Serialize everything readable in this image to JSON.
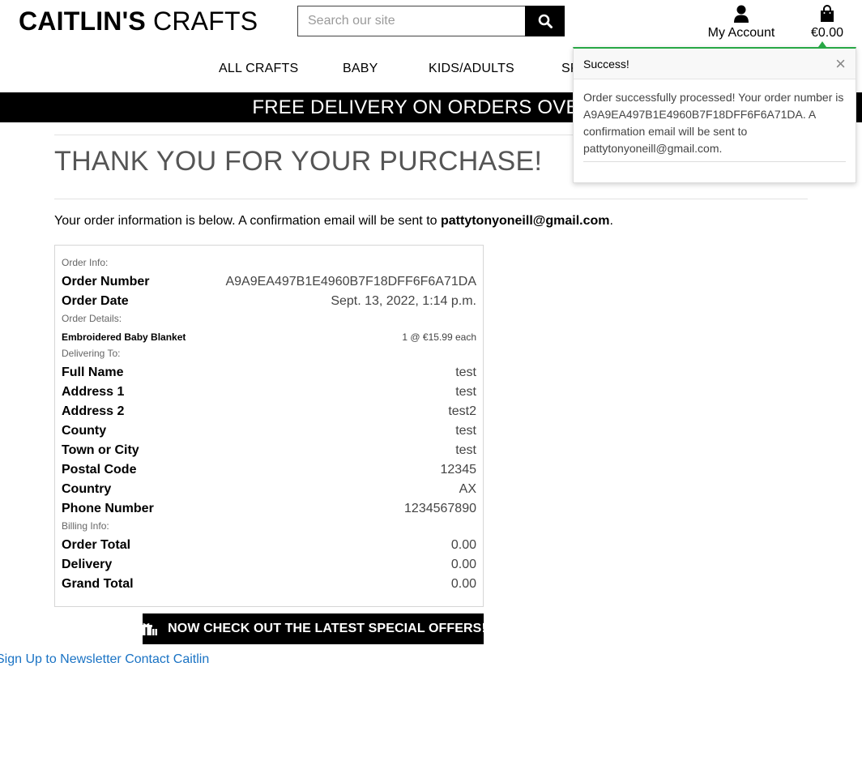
{
  "header": {
    "logo_bold": "CAITLIN'S",
    "logo_light": " CRAFTS",
    "search_placeholder": "Search our site",
    "account_label": "My Account",
    "cart_total": "€0.00"
  },
  "nav": {
    "items": [
      "ALL CRAFTS",
      "BABY",
      "KIDS/ADULTS",
      "SP"
    ]
  },
  "banner": "FREE DELIVERY ON ORDERS OVER €",
  "page": {
    "title": "THANK YOU FOR YOUR PURCHASE!",
    "intro_text": "Your order information is below. A confirmation email will be sent to ",
    "intro_email": "pattytonyoneill@gmail.com",
    "intro_end": "."
  },
  "order": {
    "order_info_heading": "Order Info:",
    "order_number_label": "Order Number",
    "order_number": "A9A9EA497B1E4960B7F18DFF6F6A71DA",
    "order_date_label": "Order Date",
    "order_date": "Sept. 13, 2022, 1:14 p.m.",
    "order_details_heading": "Order Details:",
    "item_name": "Embroidered Baby Blanket",
    "item_qty": "1 @ €15.99 each",
    "delivering_heading": "Delivering To:",
    "delivery": [
      {
        "label": "Full Name",
        "value": "test"
      },
      {
        "label": "Address 1",
        "value": "test"
      },
      {
        "label": "Address 2",
        "value": "test2"
      },
      {
        "label": "County",
        "value": "test"
      },
      {
        "label": "Town or City",
        "value": "test"
      },
      {
        "label": "Postal Code",
        "value": "12345"
      },
      {
        "label": "Country",
        "value": "AX"
      },
      {
        "label": "Phone Number",
        "value": "1234567890"
      }
    ],
    "billing_heading": "Billing Info:",
    "billing": [
      {
        "label": "Order Total",
        "value": "0.00"
      },
      {
        "label": "Delivery",
        "value": "0.00"
      },
      {
        "label": "Grand Total",
        "value": "0.00"
      }
    ]
  },
  "cta_label": "NOW CHECK OUT THE LATEST SPECIAL OFFERS!",
  "footer": {
    "newsletter": "Sign Up to Newsletter",
    "contact": "Contact Caitlin"
  },
  "toast": {
    "title": "Success!",
    "close": "×",
    "message": "Order successfully processed! Your order number is A9A9EA497B1E4960B7F18DFF6F6A71DA. A confirmation email will be sent to pattytonyoneill@gmail.com."
  },
  "colors": {
    "success": "#28a745",
    "link": "#1a73c4",
    "banner_bg": "#000000"
  },
  "icons": [
    "search-icon",
    "user-icon",
    "shopping-bag-icon",
    "gift-icon",
    "close-icon"
  ]
}
